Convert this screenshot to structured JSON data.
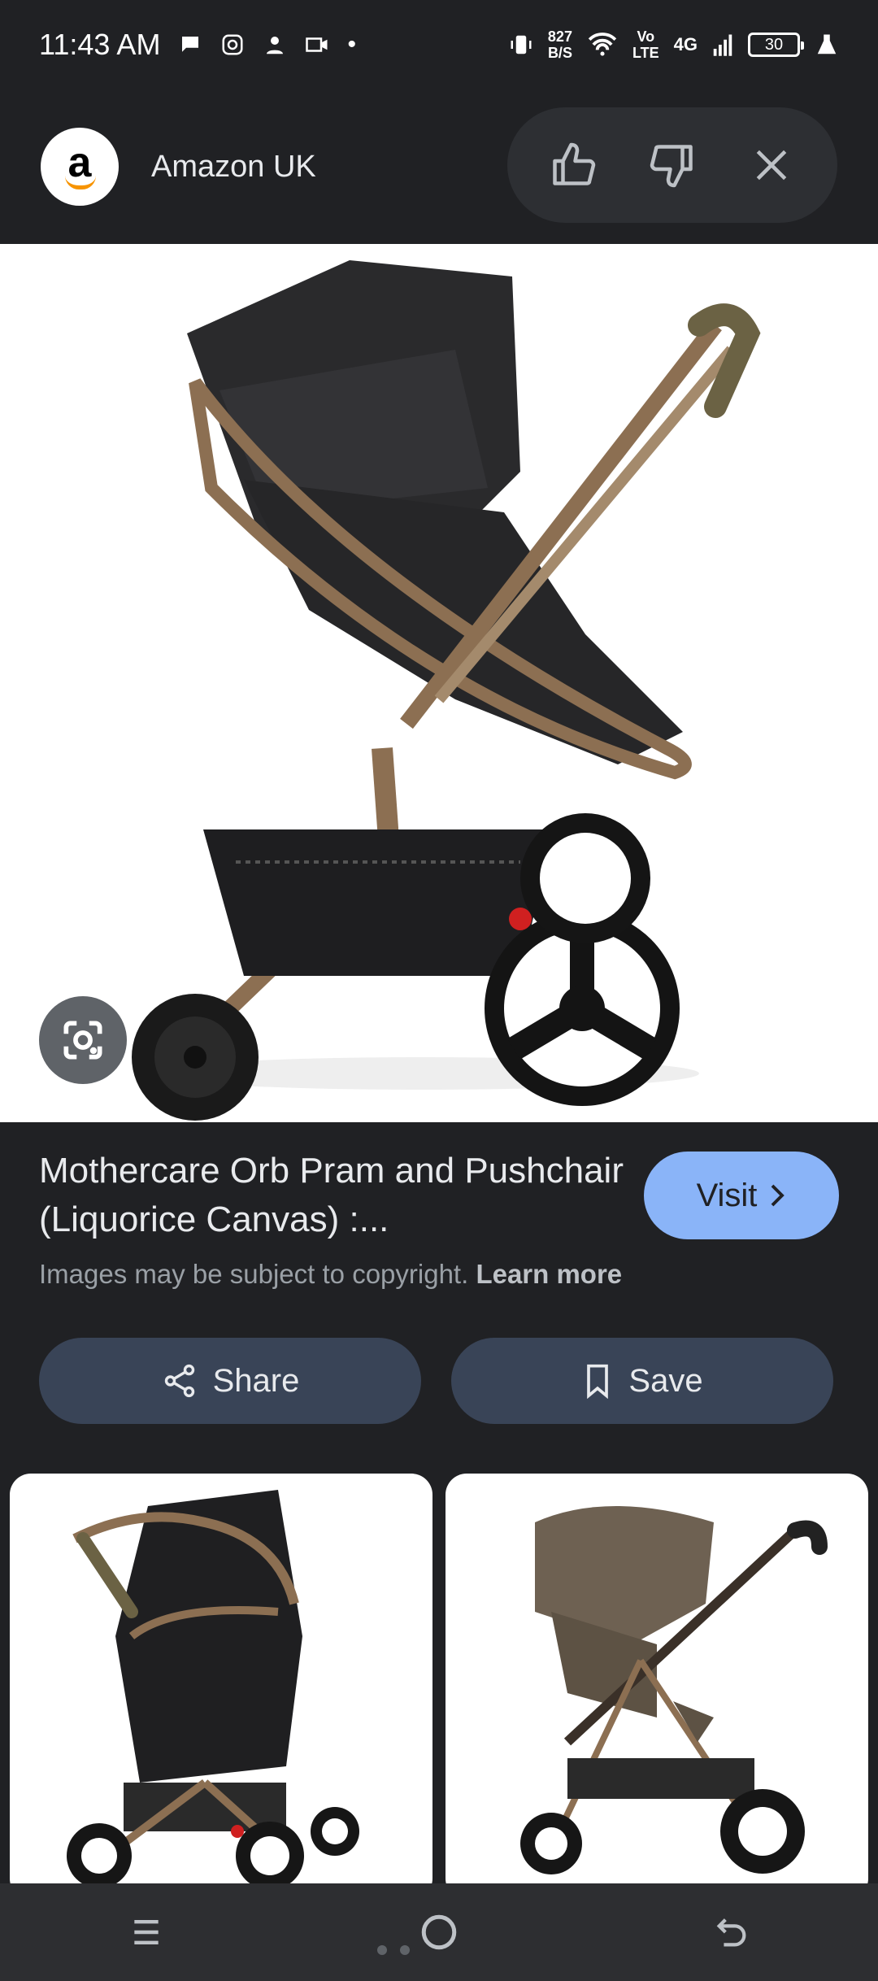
{
  "status_bar": {
    "time": "11:43 AM",
    "net_speed_value": "827",
    "net_speed_unit": "B/S",
    "volte_top": "Vo",
    "volte_bottom": "LTE",
    "network": "4G",
    "battery": "30"
  },
  "source": {
    "avatar_letter": "a",
    "name": "Amazon UK"
  },
  "result": {
    "title": "Mothercare Orb Pram and Pushchair (Liquorice Canvas) :...",
    "copyright_text": "Images may be subject to copyright.",
    "learn_more": "Learn more",
    "visit_label": "Visit"
  },
  "actions": {
    "share_label": "Share",
    "save_label": "Save"
  },
  "icons": {
    "thumbs_up": "thumbs-up-icon",
    "thumbs_down": "thumbs-down-icon",
    "close": "close-icon",
    "lens": "lens-search-icon",
    "share": "share-icon",
    "bookmark": "bookmark-icon"
  },
  "colors": {
    "background": "#202124",
    "visit_button": "#8ab4f8",
    "action_button": "#394457"
  }
}
